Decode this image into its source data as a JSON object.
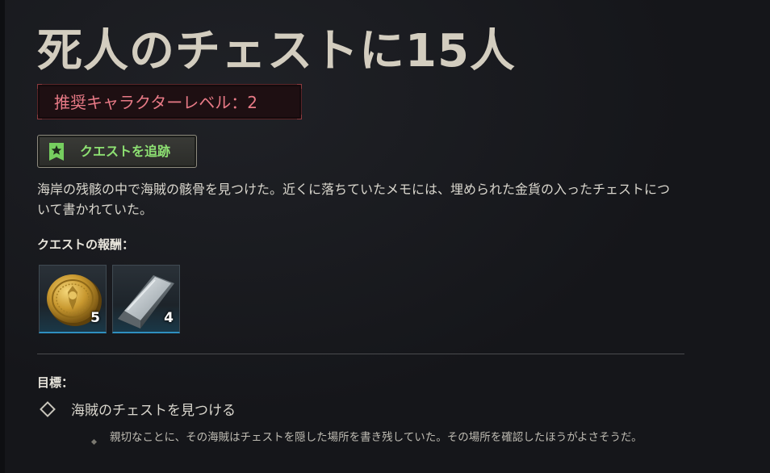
{
  "quest": {
    "title": "死人のチェストに15人",
    "recommended_level": "推奨キャラクターレベル：2",
    "track_button_label": "クエストを追跡",
    "description": "海岸の残骸の中で海賊の骸骨を見つけた。近くに落ちていたメモには、埋められた金貨の入ったチェストについて書かれていた。",
    "rewards_label": "クエストの報酬：",
    "rewards": [
      {
        "icon": "gold-coin-icon",
        "count": "5"
      },
      {
        "icon": "iron-ingot-icon",
        "count": "4"
      }
    ],
    "objectives_label": "目標：",
    "objective": {
      "text": "海賊のチェストを見つける",
      "hint": "親切なことに、その海賊はチェストを隠した場所を書き残していた。その場所を確認したほうがよさそうだ。"
    }
  },
  "colors": {
    "background": "#15161a",
    "title": "#d3cdbf",
    "level_text": "#e87a86",
    "level_border": "#5a2528",
    "track_label": "#8de072",
    "reward_slot_accent": "#2f8fc0"
  }
}
